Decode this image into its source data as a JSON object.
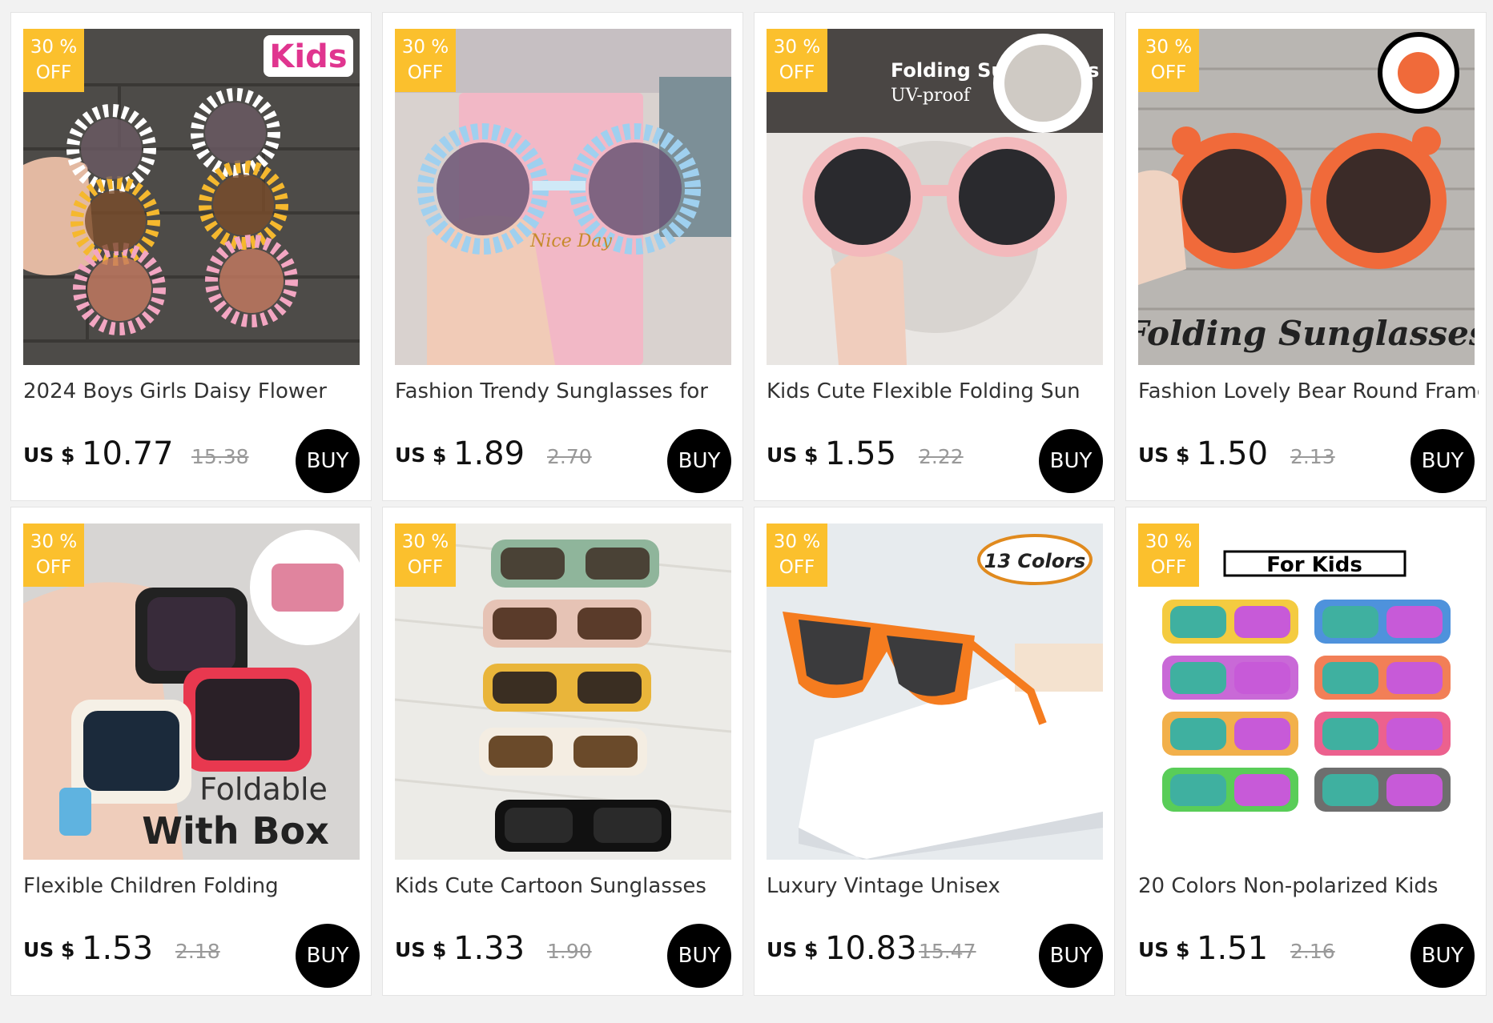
{
  "badge": {
    "percent": "30 %",
    "off": "OFF"
  },
  "products": [
    {
      "title": "2024 Boys Girls Daisy Flower",
      "currency": "US $",
      "price": "10.77",
      "old_price": "15.38",
      "buy": "BUY",
      "image": {
        "label": "Kids",
        "scene": "stacked daisy flower sunglasses on brick wall",
        "colors": [
          "#ffffff",
          "#f5b82e",
          "#f3a6c2"
        ]
      }
    },
    {
      "title": "Fashion Trendy Sunglasses for",
      "currency": "US $",
      "price": "1.89",
      "old_price": "2.70",
      "buy": "BUY",
      "image": {
        "label": "Nice Day",
        "scene": "blue daisy sunglasses on pink card",
        "colors": [
          "#9fd0ef"
        ]
      }
    },
    {
      "title": "Kids Cute Flexible Folding Sun",
      "currency": "US $",
      "price": "1.55",
      "old_price": "2.22",
      "buy": "BUY",
      "image": {
        "label": "Folding Sunglasses",
        "sublabel": "UV-proof",
        "scene": "pink round folding sunglasses with case",
        "colors": [
          "#f3b9bc"
        ]
      }
    },
    {
      "title": "Fashion Lovely Bear Round Frame",
      "currency": "US $",
      "price": "1.50",
      "old_price": "2.13",
      "buy": "BUY",
      "image": {
        "label": "Folding Sunglasses",
        "scene": "orange bear ear sunglasses on brick wall",
        "colors": [
          "#f06a3a"
        ]
      }
    },
    {
      "title": "Flexible Children Folding",
      "currency": "US $",
      "price": "1.53",
      "old_price": "2.18",
      "buy": "BUY",
      "image": {
        "label": "Foldable",
        "sublabel": "With Box",
        "scene": "folded square kids sunglasses in hand",
        "colors": [
          "#222222",
          "#e8384f",
          "#f5f0e6"
        ]
      }
    },
    {
      "title": "Kids Cute Cartoon Sunglasses",
      "currency": "US $",
      "price": "1.33",
      "old_price": "1.90",
      "buy": "BUY",
      "image": {
        "scene": "five rectangular sunglasses on fabric",
        "colors": [
          "#8fb59b",
          "#e6c3b5",
          "#e9b53a",
          "#f4ede2",
          "#111111"
        ]
      }
    },
    {
      "title": "Luxury Vintage Unisex",
      "currency": "US $",
      "price": "10.83",
      "old_price": "15.47",
      "buy": "BUY",
      "image": {
        "label": "13 Colors",
        "scene": "orange wayfarer sunglasses on white blocks",
        "colors": [
          "#f57c1f"
        ]
      }
    },
    {
      "title": "20 Colors Non-polarized Kids",
      "currency": "US $",
      "price": "1.51",
      "old_price": "2.16",
      "buy": "BUY",
      "image": {
        "label": "For Kids",
        "scene": "eight colored mirrored sunglasses",
        "colors": [
          "#f2c21f",
          "#2f7fd6",
          "#c04fd0",
          "#f0683a",
          "#f0a22b",
          "#e9457a",
          "#3cc43b",
          "#555555"
        ]
      }
    }
  ]
}
